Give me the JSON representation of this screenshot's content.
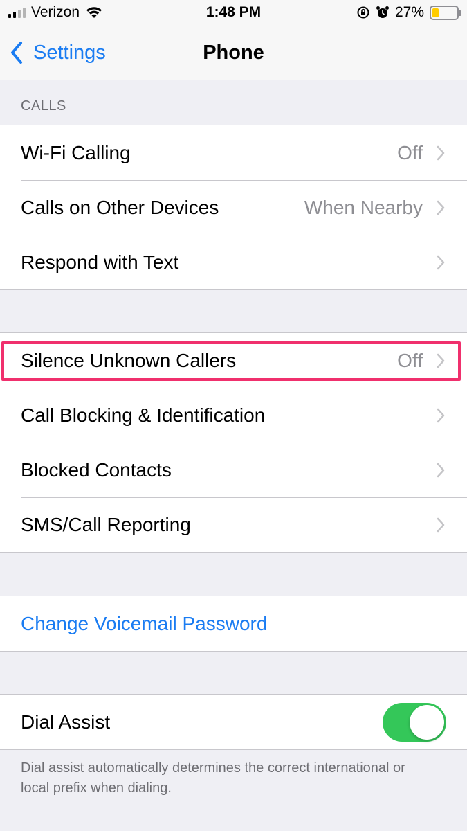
{
  "status_bar": {
    "carrier": "Verizon",
    "time": "1:48 PM",
    "battery_percent_label": "27%",
    "battery_level": 0.27,
    "signal_icon": "cellular-signal-icon",
    "wifi_icon": "wifi-icon",
    "rotation_lock_icon": "rotation-lock-icon",
    "alarm_icon": "alarm-icon"
  },
  "nav": {
    "back_label": "Settings",
    "title": "Phone"
  },
  "calls_section": {
    "header": "CALLS",
    "rows": [
      {
        "label": "Wi-Fi Calling",
        "value": "Off"
      },
      {
        "label": "Calls on Other Devices",
        "value": "When Nearby"
      },
      {
        "label": "Respond with Text",
        "value": ""
      }
    ]
  },
  "callers_section": {
    "rows": [
      {
        "label": "Silence Unknown Callers",
        "value": "Off"
      },
      {
        "label": "Call Blocking & Identification",
        "value": ""
      },
      {
        "label": "Blocked Contacts",
        "value": ""
      },
      {
        "label": "SMS/Call Reporting",
        "value": ""
      }
    ]
  },
  "voicemail_section": {
    "link_label": "Change Voicemail Password"
  },
  "dial_assist_section": {
    "label": "Dial Assist",
    "enabled": true,
    "footer": "Dial assist automatically determines the correct international or local prefix when dialing."
  },
  "colors": {
    "accent": "#1a7cf2",
    "toggle_on": "#34c759",
    "highlight": "#f0306d",
    "background": "#efeff4"
  }
}
